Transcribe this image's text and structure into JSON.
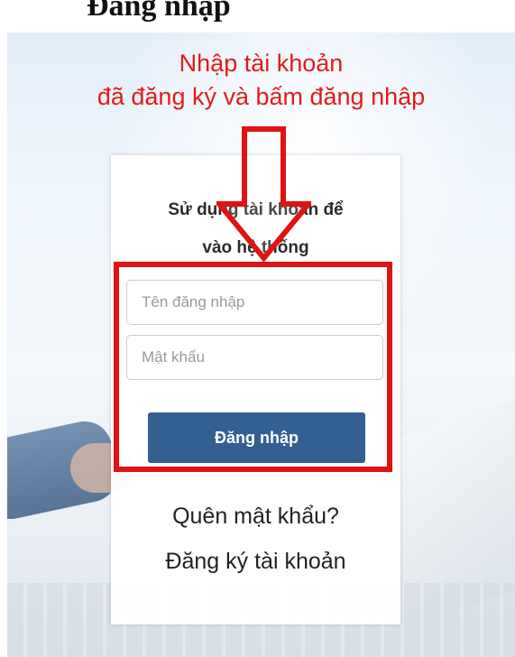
{
  "top_heading": {
    "text": "Đăng nhập"
  },
  "instruction": {
    "line1": "Nhập tài khoản",
    "line2": "đã đăng ký và bấm đăng nhập",
    "color": "#e31b1b"
  },
  "login_card": {
    "title_line1": "Sử dụng tài khoản để",
    "title_line2": "vào hệ thống",
    "username_placeholder": "Tên đăng nhập",
    "password_placeholder": "Mật khẩu",
    "login_button": "Đăng nhập",
    "forgot_password_link": "Quên mật khẩu?",
    "register_link": "Đăng ký tài khoản"
  },
  "colors": {
    "button": "#345f93",
    "highlight": "#e01313"
  },
  "icons": {
    "annotation_arrow": "down-arrow-icon"
  }
}
